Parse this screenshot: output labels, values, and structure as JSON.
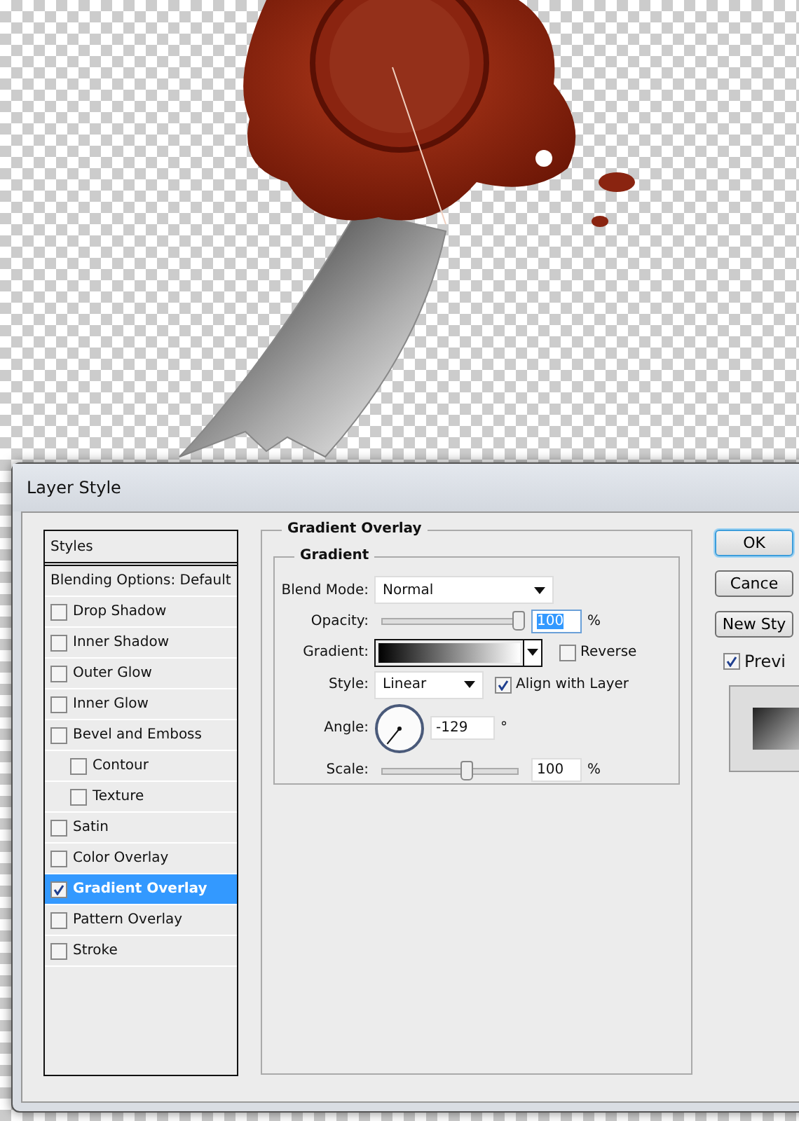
{
  "window": {
    "title": "Layer Style"
  },
  "styles_list": {
    "header": "Styles",
    "items": [
      {
        "label": "Blending Options: Default",
        "kind": "option",
        "selected": false
      },
      {
        "label": "Drop Shadow",
        "kind": "effect",
        "checked": false,
        "selected": false
      },
      {
        "label": "Inner Shadow",
        "kind": "effect",
        "checked": false,
        "selected": false
      },
      {
        "label": "Outer Glow",
        "kind": "effect",
        "checked": false,
        "selected": false
      },
      {
        "label": "Inner Glow",
        "kind": "effect",
        "checked": false,
        "selected": false
      },
      {
        "label": "Bevel and Emboss",
        "kind": "effect",
        "checked": false,
        "selected": false,
        "children": [
          {
            "label": "Contour",
            "kind": "effect",
            "checked": false,
            "selected": false
          },
          {
            "label": "Texture",
            "kind": "effect",
            "checked": false,
            "selected": false
          }
        ]
      },
      {
        "label": "Satin",
        "kind": "effect",
        "checked": false,
        "selected": false
      },
      {
        "label": "Color Overlay",
        "kind": "effect",
        "checked": false,
        "selected": false
      },
      {
        "label": "Gradient Overlay",
        "kind": "effect",
        "checked": true,
        "selected": true
      },
      {
        "label": "Pattern Overlay",
        "kind": "effect",
        "checked": false,
        "selected": false
      },
      {
        "label": "Stroke",
        "kind": "effect",
        "checked": false,
        "selected": false
      }
    ]
  },
  "panel": {
    "title": "Gradient Overlay",
    "group_title": "Gradient",
    "blend_mode": {
      "label": "Blend Mode:",
      "value": "Normal"
    },
    "opacity": {
      "label": "Opacity:",
      "level": 1.0,
      "value": "100",
      "value_selected": true,
      "unit": "%"
    },
    "gradient": {
      "label": "Gradient:"
    },
    "reverse": {
      "label": "Reverse",
      "checked": false
    },
    "style": {
      "label": "Style:",
      "value": "Linear"
    },
    "align": {
      "label": "Align with Layer",
      "checked": true
    },
    "angle": {
      "label": "Angle:",
      "value": "-129",
      "unit": "°"
    },
    "scale": {
      "label": "Scale:",
      "level": 0.62,
      "value": "100",
      "value_selected": false,
      "unit": "%"
    }
  },
  "buttons": [
    {
      "label": "OK",
      "default": true
    },
    {
      "label": "Cance",
      "default": false
    },
    {
      "label": "New Sty",
      "default": false
    }
  ],
  "preview": {
    "label": "Previ",
    "checked": true
  }
}
